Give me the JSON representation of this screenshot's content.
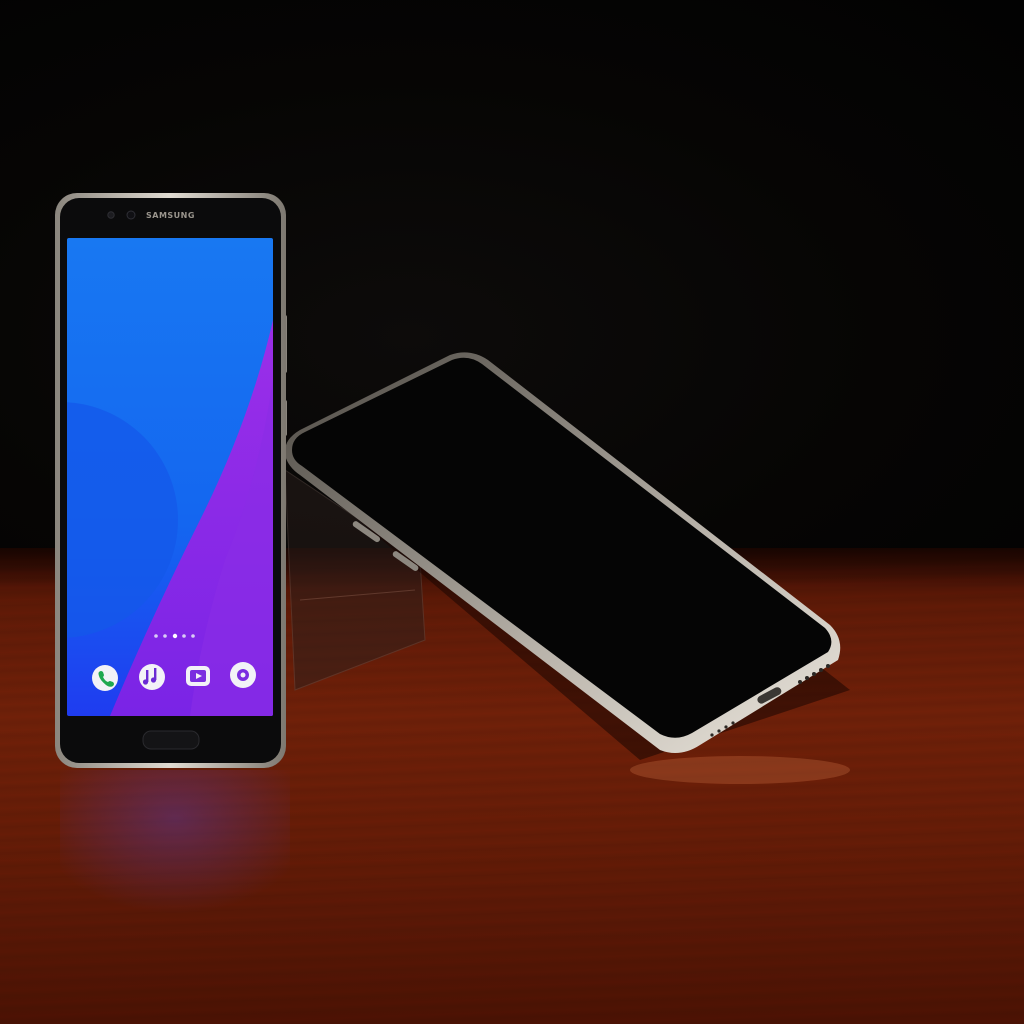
{
  "image": {
    "brand_label": "SAMSUNG",
    "colors": {
      "wallpaper_blue": "#1a6df5",
      "wallpaper_purple": "#8a2be2",
      "table_wood": "#6e2009",
      "background": "#040303",
      "frame_silver": "#c9c4bb"
    },
    "dock_icons": [
      "phone-icon",
      "music-icon",
      "camera-icon",
      "circle-icon"
    ],
    "page_indicator_dots": 5
  }
}
